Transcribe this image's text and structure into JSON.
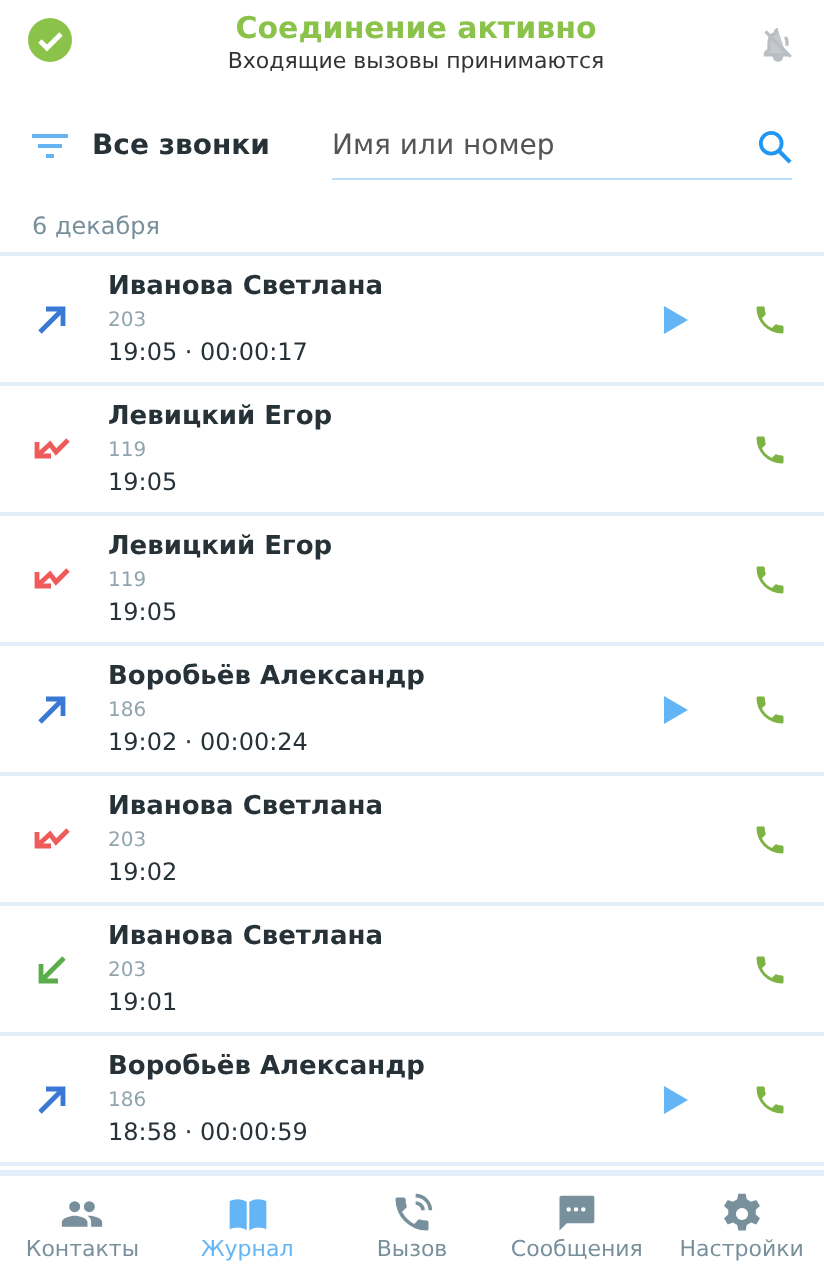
{
  "status": {
    "title": "Соединение активно",
    "subtitle": "Входящие вызовы принимаются",
    "connected": true
  },
  "filter": {
    "label": "Все звонки"
  },
  "search": {
    "placeholder": "Имя или номер"
  },
  "date": "6 декабря",
  "calls": [
    {
      "kind": "outgoing",
      "name": "Иванова Светлана",
      "number": "203",
      "time": "19:05 · 00:00:17",
      "recording": true
    },
    {
      "kind": "missed",
      "name": "Левицкий Егор",
      "number": "119",
      "time": "19:05",
      "recording": false
    },
    {
      "kind": "missed",
      "name": "Левицкий Егор",
      "number": "119",
      "time": "19:05",
      "recording": false
    },
    {
      "kind": "outgoing",
      "name": "Воробьёв Александр",
      "number": "186",
      "time": "19:02 · 00:00:24",
      "recording": true
    },
    {
      "kind": "missed",
      "name": "Иванова Светлана",
      "number": "203",
      "time": "19:02",
      "recording": false
    },
    {
      "kind": "incoming",
      "name": "Иванова Светлана",
      "number": "203",
      "time": "19:01",
      "recording": false
    },
    {
      "kind": "outgoing",
      "name": "Воробьёв Александр",
      "number": "186",
      "time": "18:58 · 00:00:59",
      "recording": true
    }
  ],
  "nav": [
    {
      "kind": "contacts",
      "label": "Контакты",
      "selected": false
    },
    {
      "kind": "journal",
      "label": "Журнал",
      "selected": true
    },
    {
      "kind": "call",
      "label": "Вызов",
      "selected": false
    },
    {
      "kind": "messages",
      "label": "Сообщения",
      "selected": false
    },
    {
      "kind": "settings",
      "label": "Настройки",
      "selected": false
    }
  ]
}
